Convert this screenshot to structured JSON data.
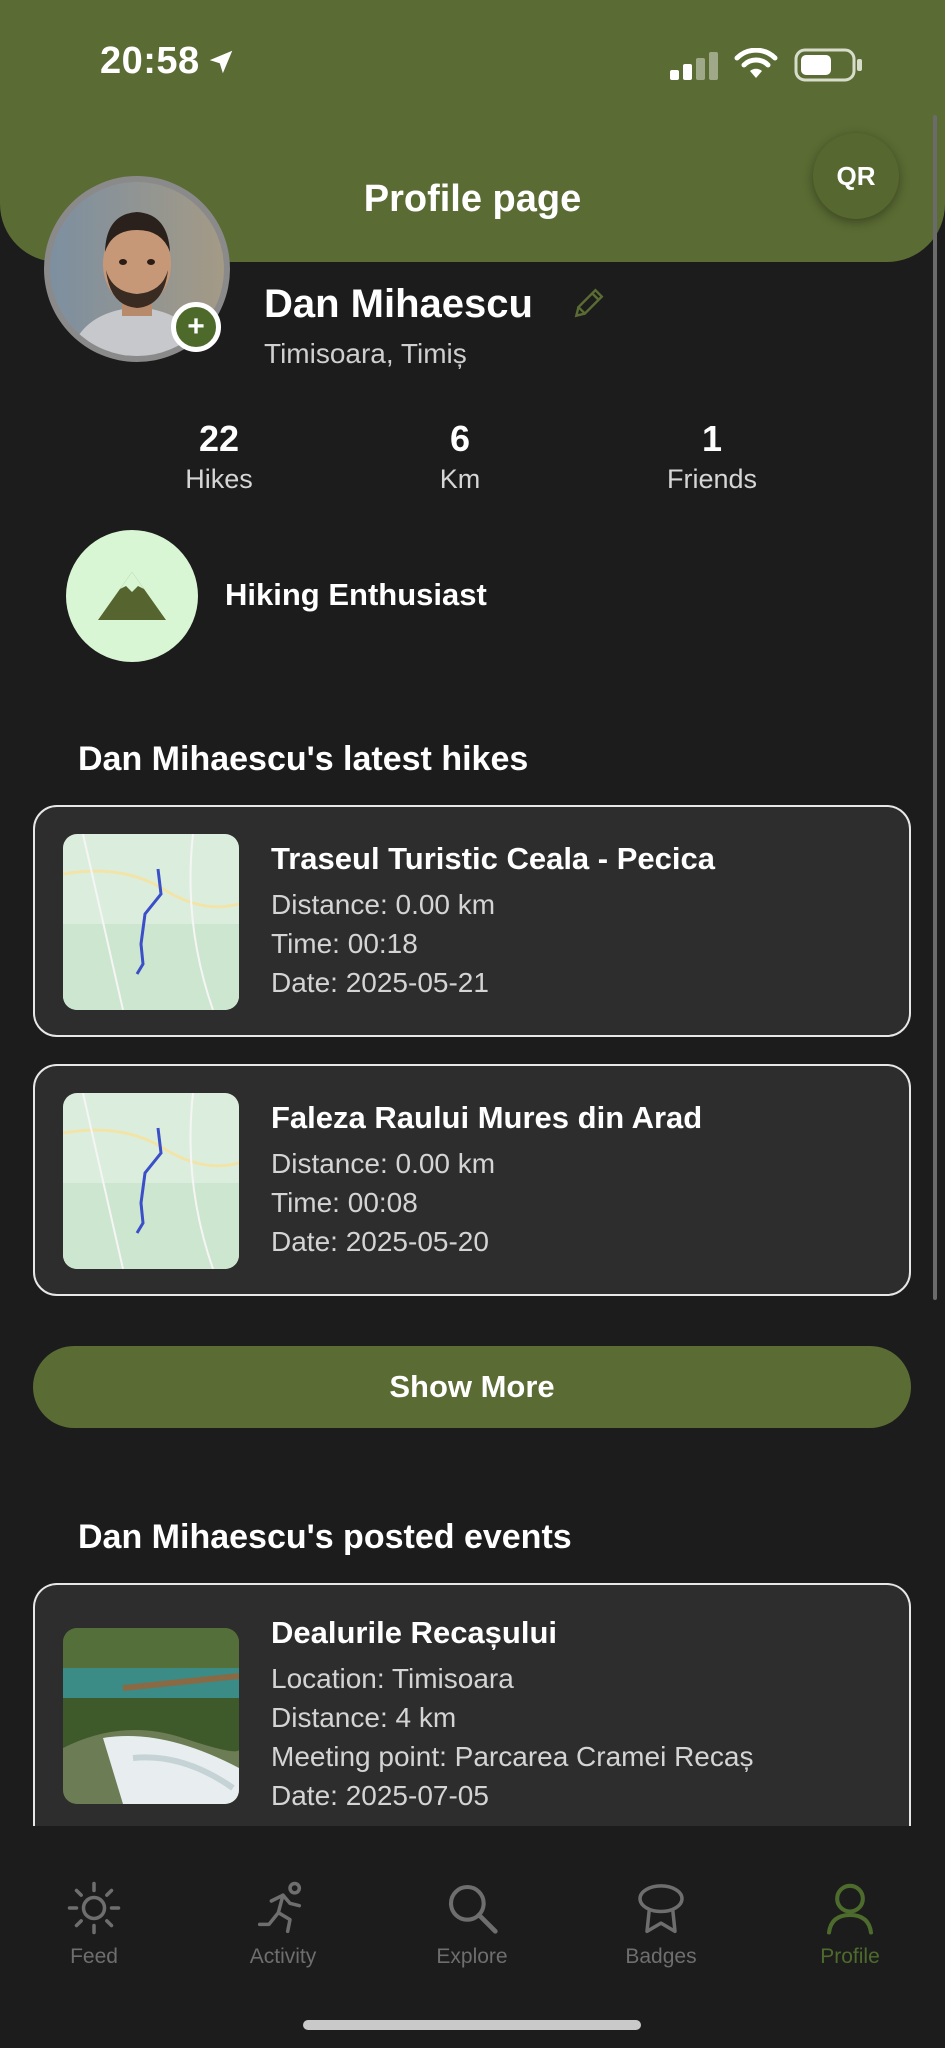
{
  "status": {
    "time": "20:58"
  },
  "header": {
    "title": "Profile page",
    "qr_label": "QR"
  },
  "profile": {
    "name": "Dan Mihaescu",
    "location": "Timisoara, Timiș",
    "add_label": "+"
  },
  "stats": [
    {
      "value": "22",
      "label": "Hikes"
    },
    {
      "value": "6",
      "label": "Km"
    },
    {
      "value": "1",
      "label": "Friends"
    }
  ],
  "badge": {
    "label": "Hiking Enthusiast",
    "icon": "mountain-icon"
  },
  "hikes": {
    "title": "Dan Mihaescu's latest hikes",
    "items": [
      {
        "name": "Traseul Turistic Ceala - Pecica",
        "distance": "Distance: 0.00 km",
        "time": "Time: 00:18",
        "date": "Date: 2025-05-21"
      },
      {
        "name": "Faleza Raului Mures din Arad",
        "distance": "Distance: 0.00 km",
        "time": "Time: 00:08",
        "date": "Date: 2025-05-20"
      }
    ],
    "show_more": "Show More"
  },
  "events": {
    "title": "Dan Mihaescu's posted events",
    "items": [
      {
        "name": "Dealurile Recașului",
        "location": "Location: Timisoara",
        "distance": "Distance: 4 km",
        "meeting": "Meeting point: Parcarea Cramei Recaș",
        "date": "Date: 2025-07-05"
      }
    ]
  },
  "tabs": [
    {
      "label": "Feed",
      "icon": "sun-icon"
    },
    {
      "label": "Activity",
      "icon": "running-icon"
    },
    {
      "label": "Explore",
      "icon": "search-icon"
    },
    {
      "label": "Badges",
      "icon": "badge-icon"
    },
    {
      "label": "Profile",
      "icon": "person-icon",
      "active": true
    }
  ],
  "colors": {
    "accent": "#5a6b33",
    "background": "#1c1c1c",
    "card": "#2d2d2d",
    "active_tab": "#4d6b2c"
  }
}
